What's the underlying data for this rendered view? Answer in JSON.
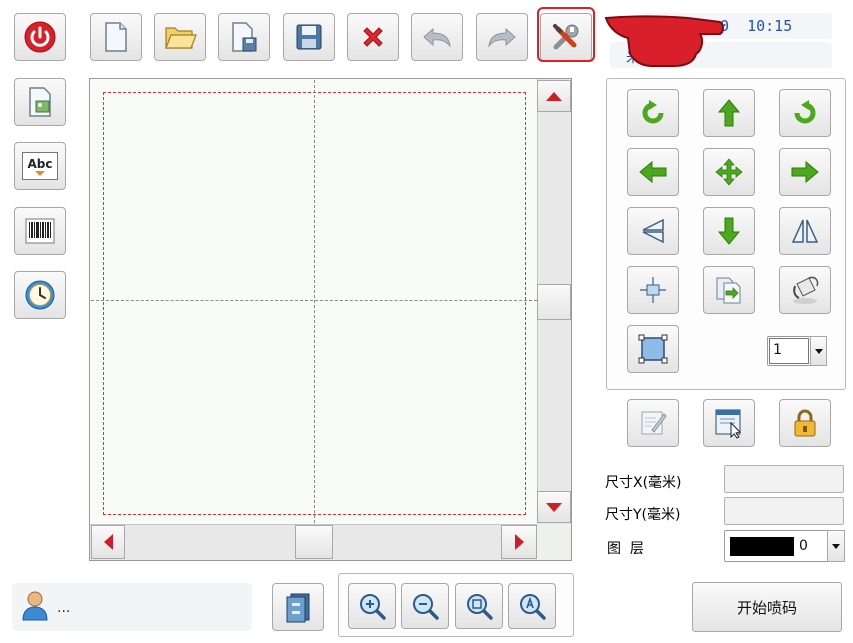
{
  "header": {
    "time_text": "0  10:15",
    "filename": "未命名"
  },
  "toolbar": {
    "icons": [
      "power-icon",
      "new-file-icon",
      "open-folder-icon",
      "save-as-icon",
      "save-icon",
      "delete-icon",
      "undo-icon",
      "redo-icon",
      "settings-tools-icon"
    ]
  },
  "left_tools": [
    "insert-image-icon",
    "text-abc-icon",
    "barcode-icon",
    "clock-icon"
  ],
  "left_tools_text": {
    "abc": "Abc"
  },
  "transform_panel": {
    "spacing_value": "1"
  },
  "properties": {
    "size_x_label": "尺寸X(毫米)",
    "size_y_label": "尺寸Y(毫米)",
    "layer_label": "图  层",
    "layer_value": "0",
    "size_x_value": "",
    "size_y_value": ""
  },
  "footer": {
    "user_text": "...",
    "start_button_label": "开始喷码"
  },
  "colors": {
    "accent_red": "#d9202a",
    "arrow_green": "#4ca81c",
    "time_text": "#2255aa"
  }
}
